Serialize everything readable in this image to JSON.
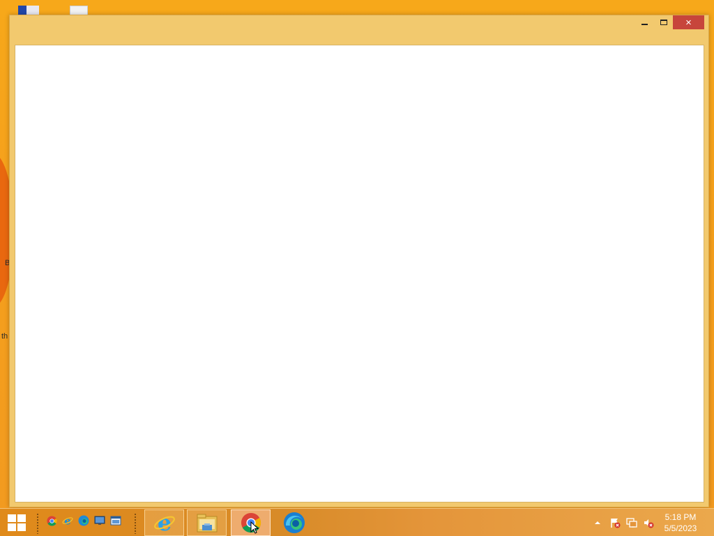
{
  "desktop": {
    "fragments": [
      "B",
      "th"
    ]
  },
  "window": {
    "title": "",
    "buttons": {
      "minimize": "minimize",
      "maximize": "maximize",
      "close": "×"
    }
  },
  "taskbar": {
    "quick_launch": [
      {
        "name": "chrome-icon"
      },
      {
        "name": "internet-explorer-icon"
      },
      {
        "name": "edge-icon"
      },
      {
        "name": "show-desktop-icon"
      },
      {
        "name": "switch-windows-icon"
      }
    ],
    "buttons": [
      {
        "name": "internet-explorer-taskbar-button",
        "active": false
      },
      {
        "name": "file-explorer-taskbar-button",
        "active": false
      },
      {
        "name": "chrome-taskbar-button",
        "active": true
      },
      {
        "name": "edge-taskbar-button",
        "active": false
      }
    ],
    "tray": {
      "icons": [
        "show-hidden-icons-icon",
        "action-center-flag-icon",
        "network-icon",
        "volume-muted-icon"
      ]
    },
    "clock": {
      "time": "5:18 PM",
      "date": "5/5/2023"
    }
  },
  "colors": {
    "wallpaper": "#f5a01c",
    "window_frame": "#f2c96e",
    "close_button": "#c7453b",
    "taskbar": "#d88b28"
  }
}
